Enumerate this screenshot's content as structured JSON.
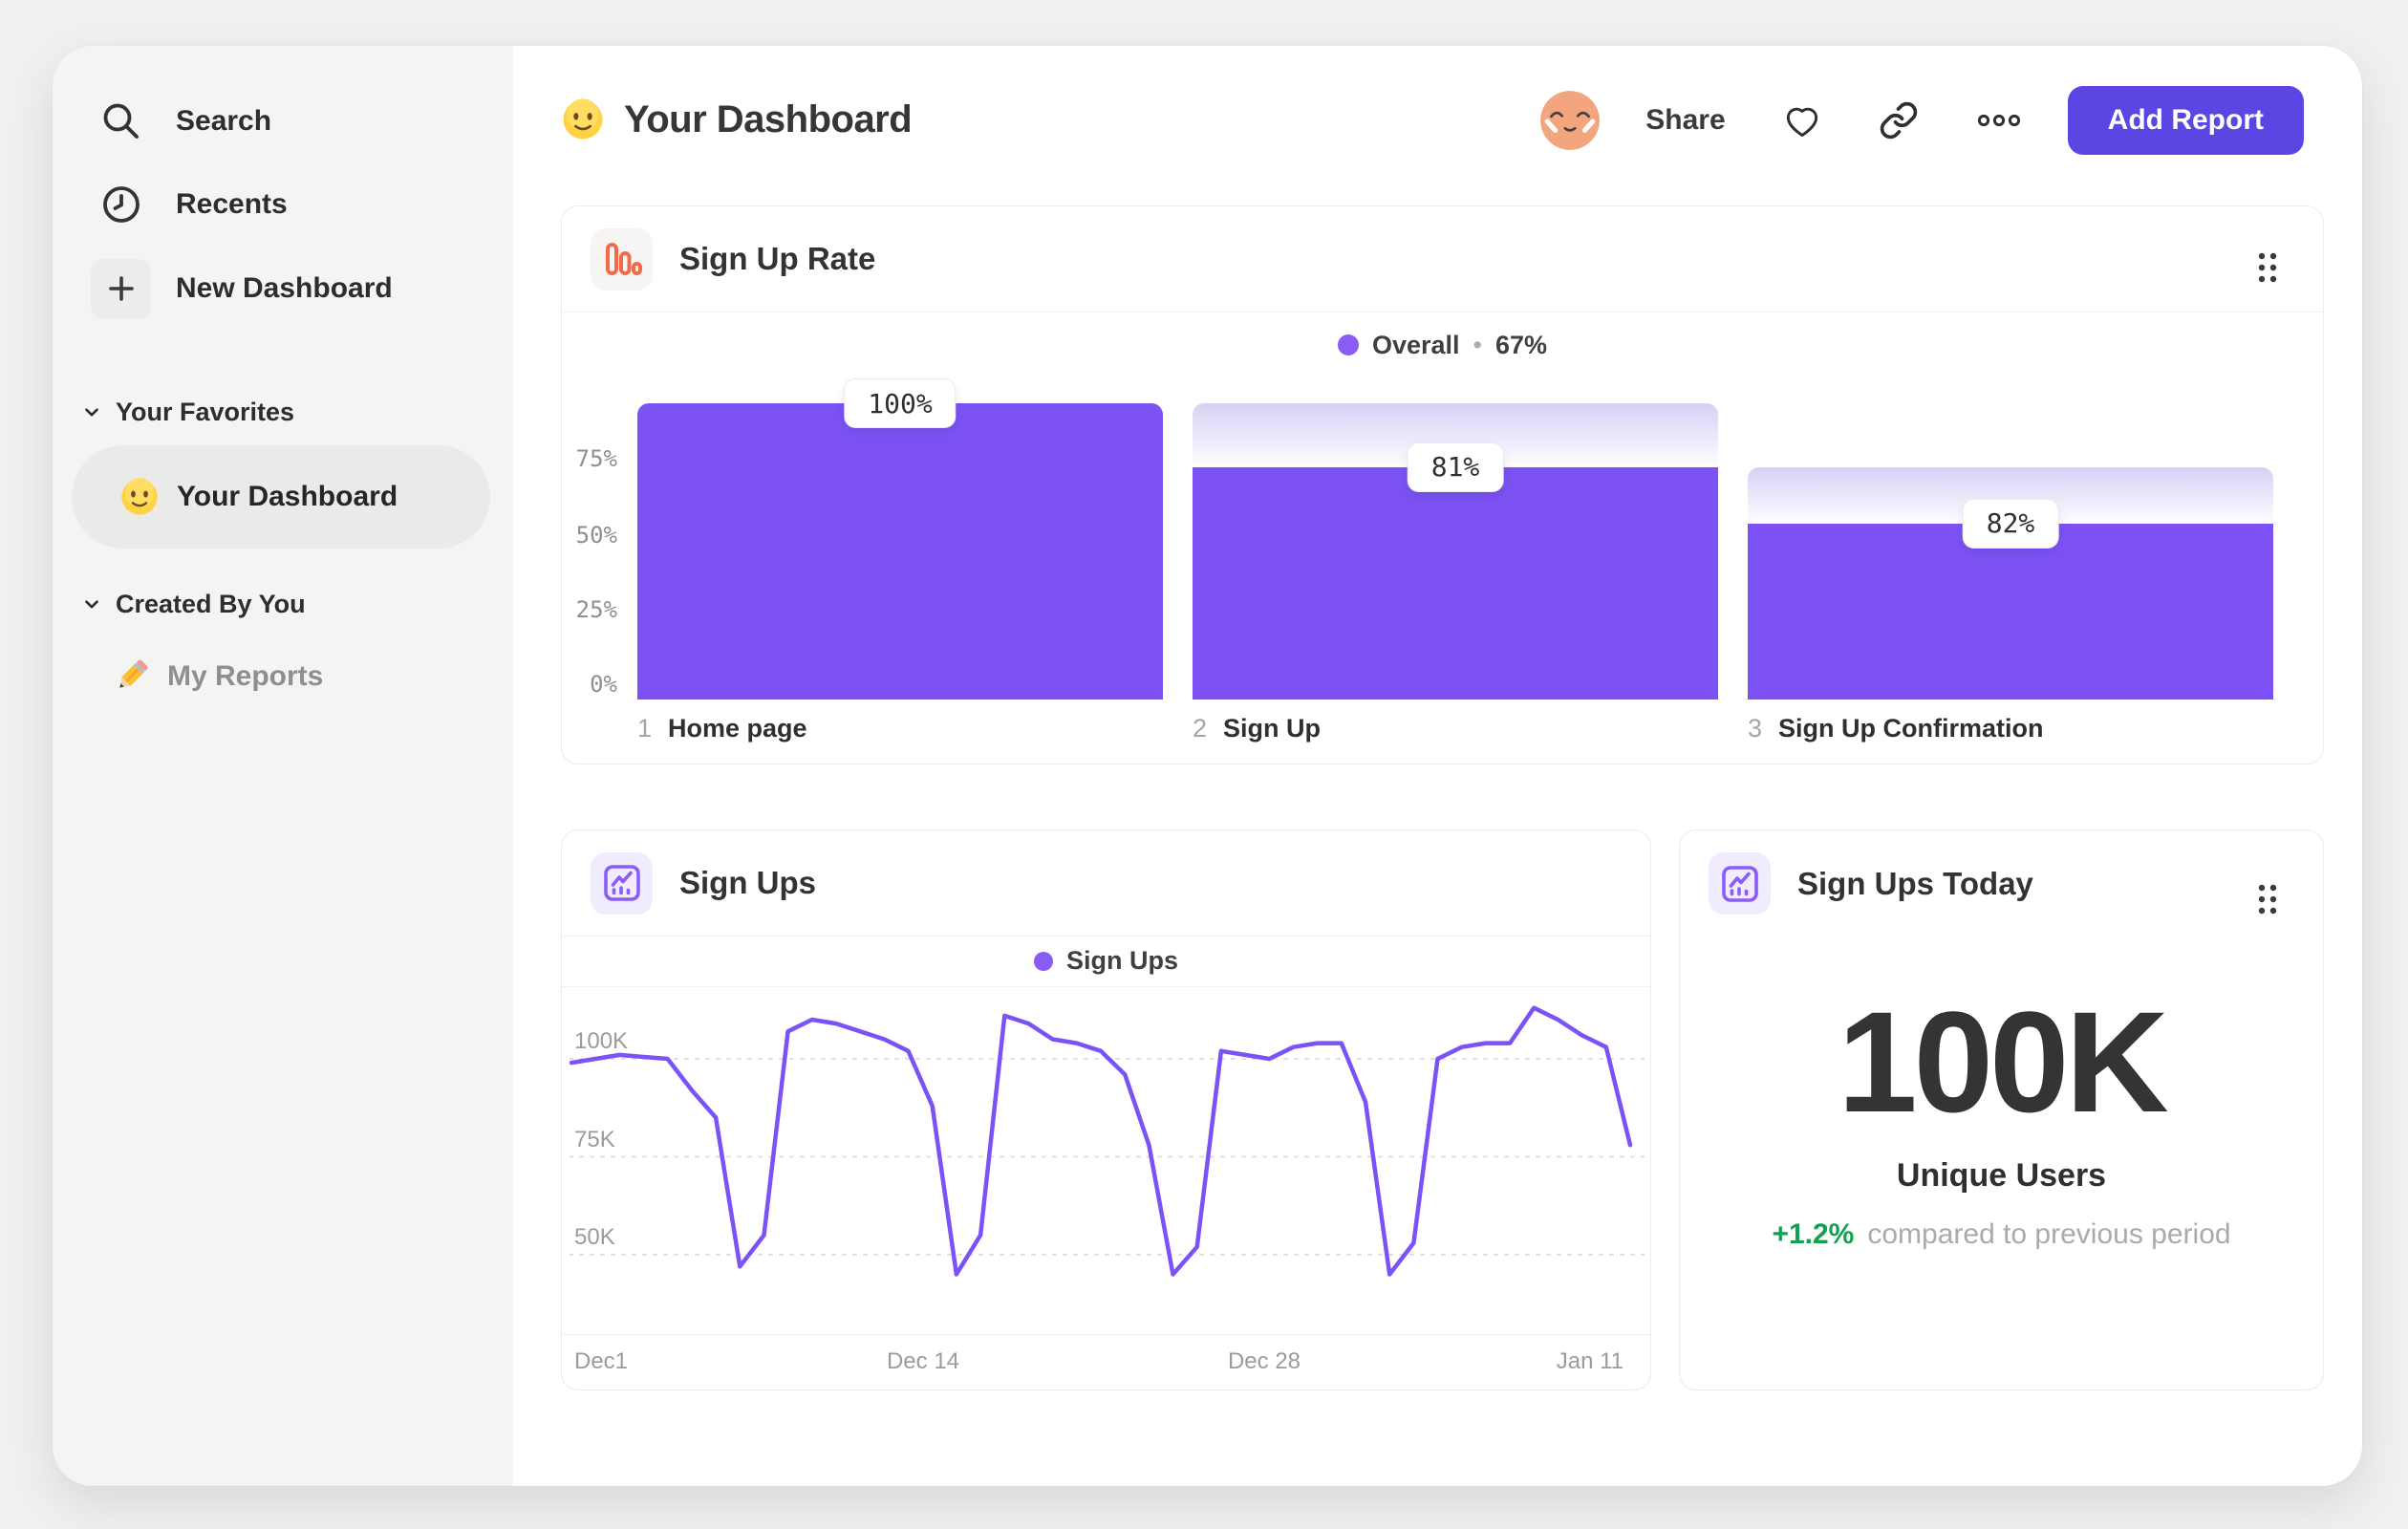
{
  "header": {
    "title": "Your Dashboard",
    "title_icon": "smiley-emoji",
    "share_label": "Share",
    "add_report_label": "Add Report"
  },
  "sidebar": {
    "nav": [
      {
        "label": "Search",
        "icon": "search-icon"
      },
      {
        "label": "Recents",
        "icon": "clock-icon"
      },
      {
        "label": "New Dashboard",
        "icon": "plus-icon"
      }
    ],
    "sections": [
      {
        "title": "Your Favorites",
        "items": [
          {
            "label": "Your Dashboard",
            "icon": "smiley-emoji",
            "selected": true
          }
        ]
      },
      {
        "title": "Created By You",
        "items": [
          {
            "label": "My Reports",
            "icon": "pencil-emoji",
            "selected": false
          }
        ]
      }
    ]
  },
  "colors": {
    "accent_purple": "#7C52F5",
    "legend_dot_purple": "#8A5CF6",
    "button_purple": "#5B46E4",
    "funnel_icon_orange": "#F26A4B",
    "positive_green": "#12A150"
  },
  "chart_data": [
    {
      "type": "bar",
      "variant": "funnel",
      "title": "Sign Up Rate",
      "legend": {
        "label": "Overall",
        "separator": "•",
        "value": "67%"
      },
      "y_ticks": [
        "75%",
        "50%",
        "25%",
        "0%"
      ],
      "ylim": [
        0,
        100
      ],
      "grid": false,
      "steps": [
        {
          "index": "1",
          "name": "Home page",
          "value_label": "100%",
          "solid_pct": 100,
          "fade_from_pct": null
        },
        {
          "index": "2",
          "name": "Sign Up",
          "value_label": "81%",
          "solid_pct": 78.4,
          "fade_from_pct": 100
        },
        {
          "index": "3",
          "name": "Sign Up Confirmation",
          "value_label": "82%",
          "solid_pct": 59.4,
          "fade_from_pct": 78.4
        }
      ]
    },
    {
      "type": "line",
      "title": "Sign Ups",
      "legend": "Sign Ups",
      "x_ticks": [
        "Dec1",
        "Dec 14",
        "Dec 28",
        "Jan 11"
      ],
      "y_ticks": [
        "100K",
        "75K",
        "50K"
      ],
      "y_grid_k": [
        100,
        75,
        50
      ],
      "ylim_k": [
        40,
        115
      ],
      "values_k": [
        99,
        100,
        101,
        100.5,
        100,
        92,
        85,
        47,
        55,
        107,
        110,
        109,
        107,
        105,
        102,
        88,
        45,
        55,
        111,
        109,
        105,
        104,
        102,
        96,
        78,
        45,
        52,
        102,
        101,
        100,
        103,
        104,
        104,
        89,
        45,
        53,
        100,
        103,
        104,
        104,
        113,
        110,
        106,
        103,
        78
      ]
    },
    {
      "type": "big-number",
      "title": "Sign Ups Today",
      "value": "100K",
      "label": "Unique Users",
      "change": "+1.2%",
      "change_note": "compared to previous period"
    }
  ]
}
